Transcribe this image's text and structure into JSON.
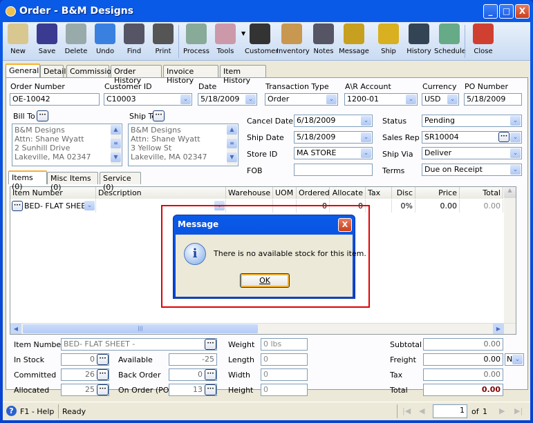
{
  "window": {
    "title": "Order - B&M Designs",
    "min": "_",
    "max": "□",
    "close": "X"
  },
  "toolbar": [
    {
      "label": "New",
      "icon": "new-icon"
    },
    {
      "label": "Save",
      "icon": "save-icon"
    },
    {
      "label": "Delete",
      "icon": "delete-icon"
    },
    {
      "label": "Undo",
      "icon": "undo-icon"
    },
    {
      "label": "Find",
      "icon": "find-icon"
    },
    {
      "label": "Print",
      "icon": "print-icon"
    },
    {
      "label": "Process",
      "icon": "process-icon"
    },
    {
      "label": "Tools",
      "icon": "tools-icon"
    },
    {
      "label": "Customer",
      "icon": "customer-icon"
    },
    {
      "label": "Inventory",
      "icon": "inventory-icon"
    },
    {
      "label": "Notes",
      "icon": "notes-icon"
    },
    {
      "label": "Message",
      "icon": "message-icon"
    },
    {
      "label": "Ship",
      "icon": "ship-icon"
    },
    {
      "label": "History",
      "icon": "history-icon"
    },
    {
      "label": "Schedule",
      "icon": "schedule-icon"
    },
    {
      "label": "Close",
      "icon": "close-icon"
    }
  ],
  "tabs": [
    "General",
    "Detail",
    "Commission",
    "Order History",
    "Invoice History",
    "Item History"
  ],
  "header": {
    "order_number": {
      "label": "Order Number",
      "value": "OE-10042"
    },
    "customer_id": {
      "label": "Customer ID",
      "value": "C10003"
    },
    "date": {
      "label": "Date",
      "value": "5/18/2009"
    },
    "transaction_type": {
      "label": "Transaction Type",
      "value": "Order"
    },
    "ar_account": {
      "label": "A\\R Account",
      "value": "1200-01"
    },
    "currency": {
      "label": "Currency",
      "value": "USD"
    },
    "po_number": {
      "label": "PO Number",
      "value": "5/18/2009"
    },
    "bill_to": {
      "label": "Bill To",
      "lines": [
        "B&M Designs",
        "Attn: Shane Wyatt",
        "2 Sunhill Drive",
        "Lakeville, MA 02347"
      ]
    },
    "ship_to": {
      "label": "Ship To",
      "lines": [
        "B&M Designs",
        "Attn: Shane Wyatt",
        "3 Yellow St",
        "Lakeville, MA 02347"
      ]
    },
    "cancel_date": {
      "label": "Cancel  Date",
      "value": "6/18/2009"
    },
    "ship_date": {
      "label": "Ship Date",
      "value": "5/18/2009"
    },
    "store_id": {
      "label": "Store ID",
      "value": "MA STORE"
    },
    "fob": {
      "label": "FOB",
      "value": ""
    },
    "status": {
      "label": "Status",
      "value": "Pending"
    },
    "sales_rep": {
      "label": "Sales Rep",
      "value": "SR10004"
    },
    "ship_via": {
      "label": "Ship Via",
      "value": "Deliver"
    },
    "terms": {
      "label": "Terms",
      "value": "Due on Receipt"
    }
  },
  "item_tabs": [
    "Items (0)",
    "Misc Items (0)",
    "Service (0)"
  ],
  "grid": {
    "columns": [
      "Item Number",
      "Description",
      "Warehouse",
      "UOM",
      "Ordered",
      "Allocate",
      "Tax",
      "Disc",
      "Price",
      "Total"
    ],
    "rows": [
      [
        "BED- FLAT SHEET",
        "",
        "",
        "",
        "0",
        "0",
        "",
        "0%",
        "0.00",
        "0.00"
      ]
    ]
  },
  "dialog": {
    "title": "Message",
    "message": "There is no available stock for this item.",
    "ok": "OK",
    "icon": "info-icon"
  },
  "details": {
    "item_number": {
      "label": "Item Number",
      "value": "BED- FLAT SHEET -"
    },
    "in_stock": {
      "label": "In Stock",
      "value": "0"
    },
    "committed": {
      "label": "Committed",
      "value": "26"
    },
    "allocated": {
      "label": "Allocated",
      "value": "25"
    },
    "available": {
      "label": "Available",
      "value": "-25"
    },
    "back_order": {
      "label": "Back Order",
      "value": "0"
    },
    "on_order": {
      "label": "On Order (PO)",
      "value": "13"
    },
    "weight": {
      "label": "Weight",
      "value": "0 lbs"
    },
    "length": {
      "label": "Length",
      "value": "0"
    },
    "width": {
      "label": "Width",
      "value": "0"
    },
    "height": {
      "label": "Height",
      "value": "0"
    },
    "subtotal": {
      "label": "Subtotal",
      "value": "0.00"
    },
    "freight": {
      "label": "Freight",
      "value": "0.00",
      "code": "N"
    },
    "tax": {
      "label": "Tax",
      "value": "0.00"
    },
    "total": {
      "label": "Total",
      "value": "0.00"
    }
  },
  "status_bar": {
    "help": "F1 - Help",
    "status": "Ready",
    "page": "1",
    "of": "of",
    "total_pages": "1"
  },
  "colors": {
    "title_bar": "#0a5ae8",
    "total_value": "#800000",
    "highlight": "#e00000"
  }
}
